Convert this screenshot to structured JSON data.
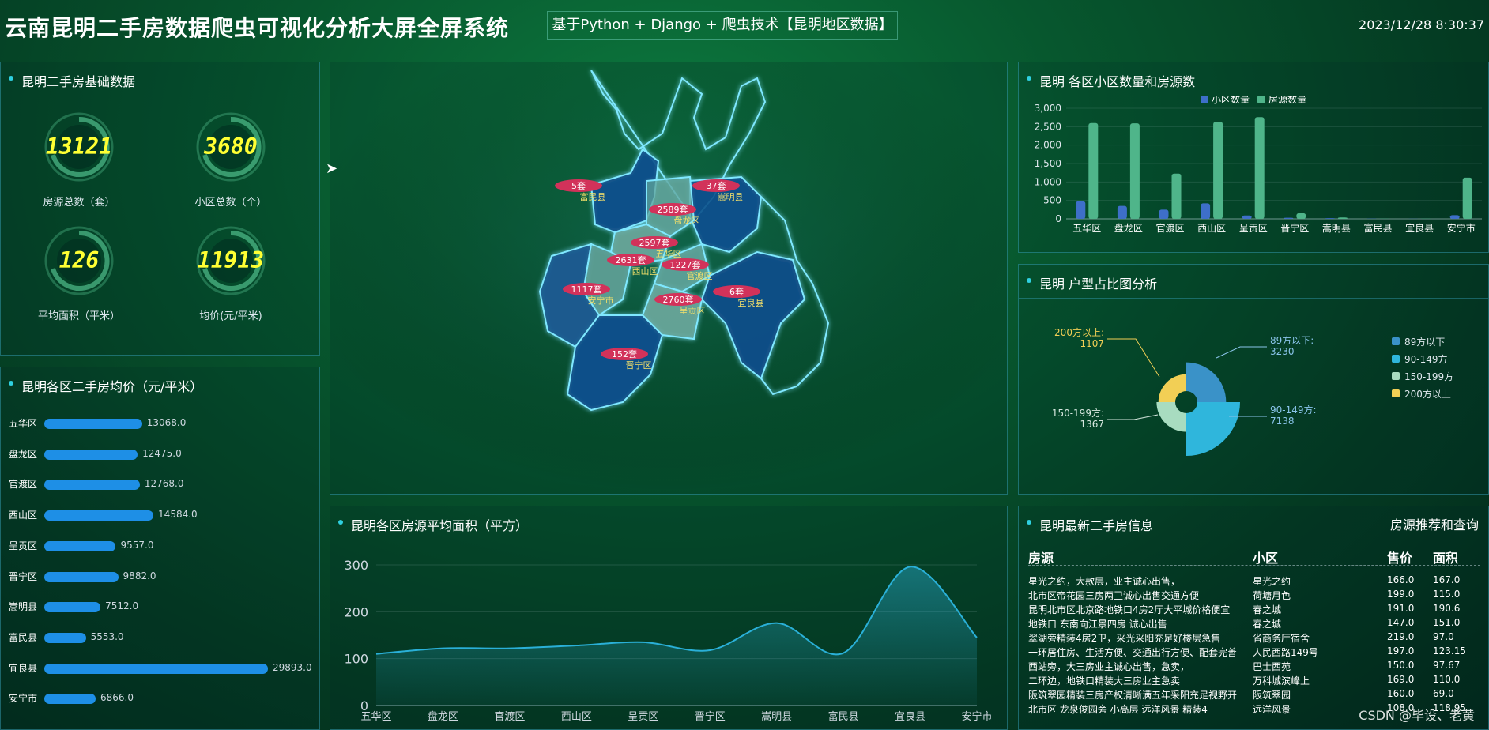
{
  "header": {
    "title": "云南昆明二手房数据爬虫可视化分析大屏全屏系统",
    "subtitle": "基于Python + Django + 爬虫技术【昆明地区数据】",
    "datetime": "2023/12/28 8:30:37"
  },
  "basic": {
    "title": "昆明二手房基础数据",
    "stats": [
      {
        "value": "13121",
        "label": "房源总数（套）"
      },
      {
        "value": "3680",
        "label": "小区总数（个）"
      },
      {
        "value": "126",
        "label": "平均面积（平米）"
      },
      {
        "value": "11913",
        "label": "均价(元/平米)"
      }
    ]
  },
  "price_panel": {
    "title": "昆明各区二手房均价（元/平米）"
  },
  "map_panel": {
    "labels": [
      {
        "count": "5套",
        "name": "富民县"
      },
      {
        "count": "37套",
        "name": "嵩明县"
      },
      {
        "count": "2589套",
        "name": "盘龙区"
      },
      {
        "count": "2597套",
        "name": "五华区"
      },
      {
        "count": "2631套",
        "name": "西山区"
      },
      {
        "count": "1227套",
        "name": "官渡区"
      },
      {
        "count": "1117套",
        "name": "安宁市"
      },
      {
        "count": "6套",
        "name": "宜良县"
      },
      {
        "count": "2760套",
        "name": "呈贡区"
      },
      {
        "count": "152套",
        "name": "晋宁区"
      }
    ]
  },
  "area_panel": {
    "title": "昆明各区房源平均面积（平方）"
  },
  "community_panel": {
    "title": "昆明 各区小区数量和房源数"
  },
  "pie_panel": {
    "title": "昆明 户型占比图分析"
  },
  "listing_panel": {
    "title": "昆明最新二手房信息",
    "right_label": "房源推荐和查询",
    "columns": [
      "房源",
      "小区",
      "售价",
      "面积"
    ],
    "rows": [
      [
        "星光之约，大款层，业主诚心出售，",
        "星光之约",
        "166.0",
        "167.0"
      ],
      [
        "北市区帝花园三房两卫诚心出售交通方便",
        "荷塘月色",
        "199.0",
        "115.0"
      ],
      [
        "昆明北市区北京路地铁口4房2厅大平城价格便宜",
        "春之城",
        "191.0",
        "190.6"
      ],
      [
        "地铁口 东南向江景四房 诚心出售",
        "春之城",
        "147.0",
        "151.0"
      ],
      [
        "翠湖旁精装4房2卫，采光采阳充足好楼层急售",
        "省商务厅宿舍",
        "219.0",
        "97.0"
      ],
      [
        "一环居住房、生活方便、交通出行方便、配套完善",
        "人民西路149号",
        "197.0",
        "123.15"
      ],
      [
        "西站旁，大三房业主诚心出售，急卖，",
        "巴士西苑",
        "150.0",
        "97.67"
      ],
      [
        "二环边，地铁口精装大三房业主急卖",
        "万科城滨峰上",
        "169.0",
        "110.0"
      ],
      [
        "阪筑翠园精装三房产权清晰满五年采阳充足视野开",
        "阪筑翠园",
        "160.0",
        "69.0"
      ],
      [
        "北市区 龙泉俊园旁 小高层 远洋风景 精装4",
        "远洋风景",
        "108.0",
        "118.95"
      ]
    ]
  },
  "watermark": "CSDN @毕设、老黄",
  "chart_data": [
    {
      "type": "bar",
      "title": "昆明各区二手房均价（元/平米）",
      "orientation": "horizontal",
      "categories": [
        "五华区",
        "盘龙区",
        "官渡区",
        "西山区",
        "呈贡区",
        "晋宁区",
        "嵩明县",
        "富民县",
        "宜良县",
        "安宁市"
      ],
      "values": [
        13068.0,
        12475.0,
        12768.0,
        14584.0,
        9557.0,
        9882.0,
        7512.0,
        5553.0,
        29893.0,
        6866.0
      ],
      "value_labels": [
        "13068.0",
        "12475.0",
        "12768.0",
        "14584.0",
        "9557.0",
        "9882.0",
        "7512.0",
        "5553.0",
        "29893.0",
        "6866.0"
      ],
      "xlim": [
        0,
        30000
      ],
      "color": "#1e8fe6"
    },
    {
      "type": "area",
      "title": "昆明各区房源平均面积（平方）",
      "categories": [
        "五华区",
        "盘龙区",
        "官渡区",
        "西山区",
        "呈贡区",
        "晋宁区",
        "嵩明县",
        "富民县",
        "宜良县",
        "安宁市"
      ],
      "values": [
        110,
        122,
        122,
        128,
        135,
        118,
        176,
        112,
        296,
        145
      ],
      "ylim": [
        0,
        300
      ],
      "yticks": [
        "0",
        "100",
        "200",
        "300"
      ],
      "grid": true,
      "color": "#2ab0d8"
    },
    {
      "type": "bar",
      "title": "昆明 各区小区数量和房源数",
      "categories": [
        "五华区",
        "盘龙区",
        "官渡区",
        "西山区",
        "呈贡区",
        "晋宁区",
        "嵩明县",
        "富民县",
        "宜良县",
        "安宁市"
      ],
      "series": [
        {
          "name": "小区数量",
          "values": [
            480,
            350,
            250,
            420,
            90,
            30,
            20,
            5,
            4,
            100
          ],
          "color": "#3e6fc9"
        },
        {
          "name": "房源数量",
          "values": [
            2597,
            2589,
            1227,
            2631,
            2760,
            152,
            37,
            5,
            6,
            1117
          ],
          "color": "#4fb58a"
        }
      ],
      "ylim": [
        0,
        3000
      ],
      "yticks": [
        "0",
        "500",
        "1,000",
        "1,500",
        "2,000",
        "2,500",
        "3,000"
      ],
      "legend": "top-center"
    },
    {
      "type": "pie",
      "title": "昆明 户型占比图分析",
      "rose": true,
      "slices": [
        {
          "name": "89方以下",
          "value": 3230,
          "color": "#3a92c8"
        },
        {
          "name": "90-149方",
          "value": 7138,
          "color": "#2fb6dc"
        },
        {
          "name": "150-199方",
          "value": 1367,
          "color": "#a8dcc0"
        },
        {
          "name": "200方以上",
          "value": 1107,
          "color": "#f2cf55"
        }
      ],
      "callouts": [
        {
          "name": "89方以下:",
          "value": "3230",
          "color": "#8ac4ea"
        },
        {
          "name": "90-149方:",
          "value": "7138",
          "color": "#8ac4ea"
        },
        {
          "name": "150-199方:",
          "value": "1367",
          "color": "#d8e8e0"
        },
        {
          "name": "200方以上:",
          "value": "1107",
          "color": "#f2cf55"
        }
      ],
      "legend_labels": [
        "89方以下",
        "90-149方",
        "150-199方",
        "200方以上"
      ],
      "legend": "right"
    }
  ]
}
